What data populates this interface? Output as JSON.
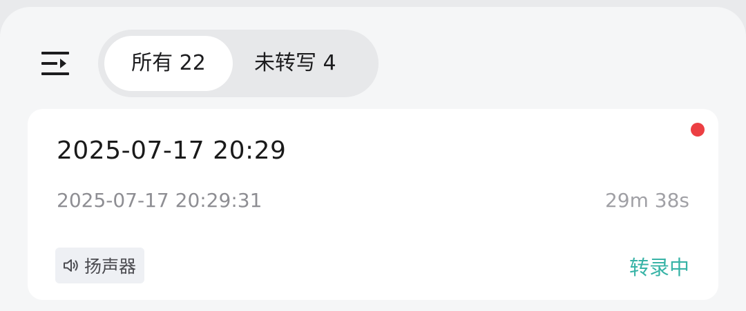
{
  "icons": {
    "menu": "menu-collapse-icon",
    "speaker": "speaker-icon"
  },
  "colors": {
    "accent": "#37b3a6",
    "unread_dot": "#ec3f43",
    "background": "#f5f6f7"
  },
  "tabs": [
    {
      "label": "所有 22",
      "active": true
    },
    {
      "label": "未转写 4",
      "active": false
    }
  ],
  "recording": {
    "title": "2025-07-17 20:29",
    "created_at": "2025-07-17 20:29:31",
    "duration": "29m 38s",
    "source": "扬声器",
    "status": "转录中",
    "unread": true
  }
}
